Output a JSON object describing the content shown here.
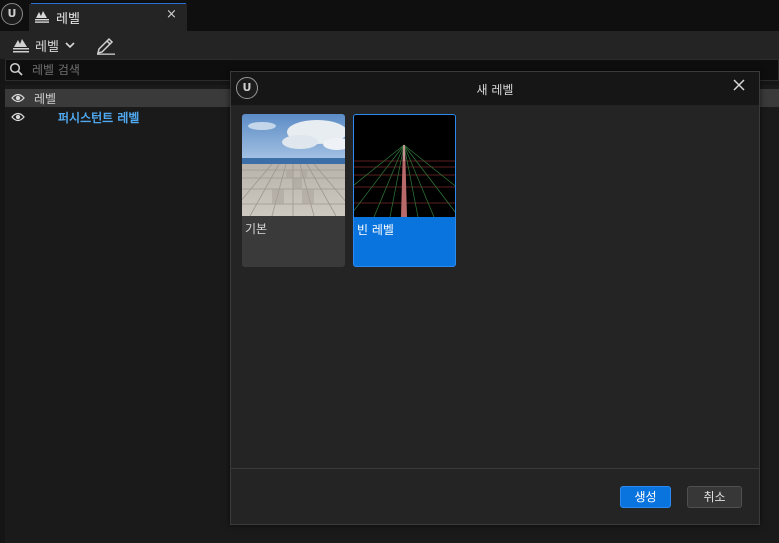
{
  "window": {
    "tab_label": "레벨",
    "tab_close": "×"
  },
  "toolbar": {
    "levels_label": "레벨",
    "levels_chevron": "⌄"
  },
  "search": {
    "placeholder": "레벨 검색",
    "value": ""
  },
  "tree": {
    "rows": [
      {
        "label": "레벨",
        "selected": true,
        "color": "#d0d0d0"
      },
      {
        "label": "퍼시스턴트 레벨",
        "selected": false,
        "color": "#4fa8f0"
      }
    ]
  },
  "dialog": {
    "title": "새 레벨",
    "templates": [
      {
        "label": "기본",
        "selected": false
      },
      {
        "label": "빈 레벨",
        "selected": true
      }
    ],
    "create_button": "생성",
    "cancel_button": "취소"
  },
  "colors": {
    "accent": "#0a74de",
    "tree_link": "#4fa8f0",
    "background": "#151515",
    "dialog_bg": "#242424"
  },
  "icons": {
    "logo": "unreal-logo-icon",
    "levels": "levels-icon",
    "pencil": "pencil-icon",
    "search": "search-icon",
    "eye": "eye-icon",
    "close": "close-icon"
  }
}
